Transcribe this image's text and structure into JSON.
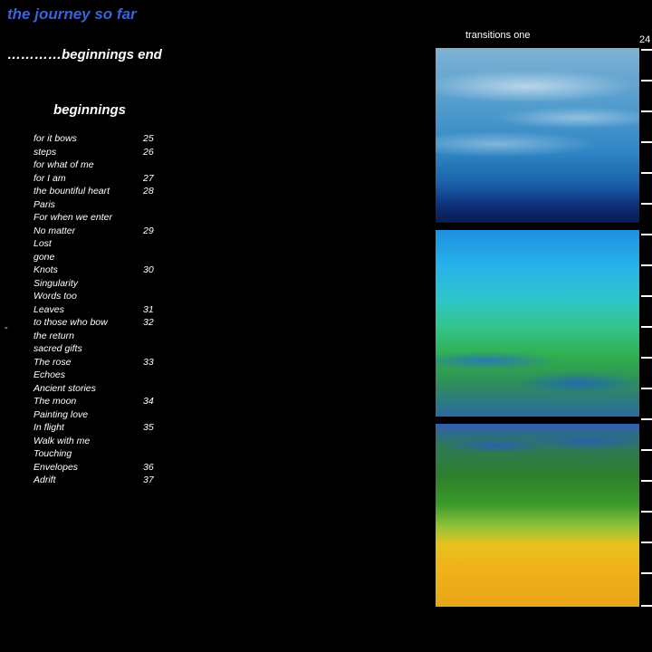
{
  "header": {
    "title": "the journey so far",
    "section_end": "…………beginnings end"
  },
  "toc": {
    "heading": "beginnings",
    "entries": [
      {
        "title": "for it bows",
        "page": "25"
      },
      {
        "title": "steps",
        "page": "26"
      },
      {
        "title": "for what of me",
        "page": ""
      },
      {
        "title": "for I am",
        "page": "27"
      },
      {
        "title": "the bountiful heart",
        "page": "28"
      },
      {
        "title": "Paris",
        "page": ""
      },
      {
        "title": "For when we enter",
        "page": ""
      },
      {
        "title": "No matter",
        "page": "29"
      },
      {
        "title": "Lost",
        "page": ""
      },
      {
        "title": "gone",
        "page": ""
      },
      {
        "title": "Knots",
        "page": "30"
      },
      {
        "title": "Singularity",
        "page": ""
      },
      {
        "title": "Words too",
        "page": ""
      },
      {
        "title": "Leaves",
        "page": "31"
      },
      {
        "title": "to those who bow",
        "page": "32"
      },
      {
        "title": "the return",
        "page": ""
      },
      {
        "title": "sacred gifts",
        "page": ""
      },
      {
        "title": "The rose",
        "page": "33"
      },
      {
        "title": "Echoes",
        "page": ""
      },
      {
        "title": "Ancient stories",
        "page": ""
      },
      {
        "title": "The moon",
        "page": "34"
      },
      {
        "title": "Painting love",
        "page": ""
      },
      {
        "title": "In flight",
        "page": "35"
      },
      {
        "title": "Walk with me",
        "page": ""
      },
      {
        "title": "Touching",
        "page": ""
      },
      {
        "title": "Envelopes",
        "page": "36"
      },
      {
        "title": "Adrift",
        "page": "37"
      }
    ]
  },
  "margin_mark": "-",
  "artwork": {
    "caption": "transitions one",
    "page_number": "24"
  },
  "colors": {
    "background": "#000000",
    "title": "#3a63d8",
    "text": "#ffffff"
  }
}
